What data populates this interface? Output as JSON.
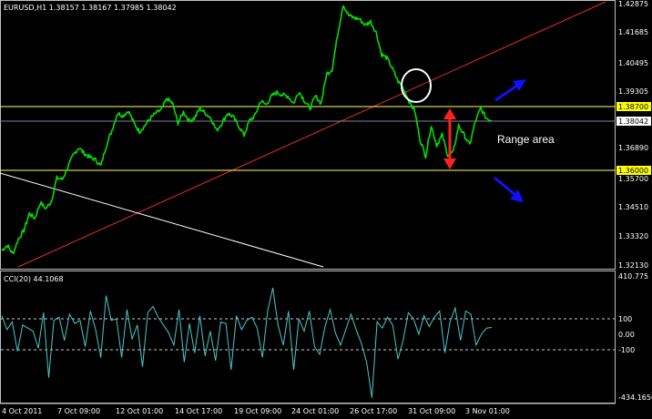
{
  "colors": {
    "background": "#000000",
    "frame": "#c0c0c0",
    "price": "#00e000",
    "trendline_up": "#e03020",
    "trendline_down": "#ffffff",
    "level": "#ffff66",
    "level_tag": "#ffff00",
    "current_price_line": "#8080a0",
    "current_price_tag": "#ffffff",
    "cci": "#4cc8c8",
    "cci_levels": "#c8c8c8",
    "arrow_blue": "#1010ff",
    "arrow_red": "#ff2020",
    "circle": "#ffffff"
  },
  "chart_data": [
    {
      "type": "line",
      "header": "EURUSD,H1  1.38157 1.38167 1.37985 1.38042",
      "symbol": "EURUSD,H1",
      "ohlc": {
        "open": "1.38157",
        "high": "1.38167",
        "low": "1.37985",
        "close": "1.38042"
      },
      "ylim": [
        1.3213,
        1.4278
      ],
      "y_ticks": [
        "1.42875",
        "1.41685",
        "1.40495",
        "1.39305",
        "1.38700",
        "1.38042",
        "1.36890",
        "1.35700",
        "1.36000",
        "1.34510",
        "1.33320",
        "1.32130"
      ],
      "x_ticks": [
        "4 Oct 2011",
        "7 Oct 09:00",
        "12 Oct 01:00",
        "14 Oct 17:00",
        "19 Oct 09:00",
        "24 Oct 01:00",
        "26 Oct 17:00",
        "31 Oct 09:00",
        "3 Nov 01:00"
      ],
      "series": [
        {
          "values": [
            1.327,
            1.329,
            1.3255,
            1.3315,
            1.335,
            1.342,
            1.34,
            1.3465,
            1.344,
            1.347,
            1.3565,
            1.356,
            1.361,
            1.366,
            1.369,
            1.3665,
            1.365,
            1.364,
            1.3615,
            1.37,
            1.376,
            1.383,
            1.382,
            1.384,
            1.379,
            1.3755,
            1.378,
            1.381,
            1.383,
            1.3845,
            1.389,
            1.387,
            1.379,
            1.3835,
            1.38,
            1.381,
            1.385,
            1.383,
            1.381,
            1.376,
            1.379,
            1.383,
            1.3815,
            1.378,
            1.374,
            1.38,
            1.382,
            1.388,
            1.3865,
            1.39,
            1.3915,
            1.3905,
            1.39,
            1.387,
            1.392,
            1.388,
            1.385,
            1.39,
            1.387,
            1.399,
            1.401,
            1.415,
            1.4275,
            1.423,
            1.422,
            1.4215,
            1.419,
            1.4205,
            1.416,
            1.407,
            1.4055,
            1.401,
            1.396,
            1.393,
            1.388,
            1.384,
            1.372,
            1.3655,
            1.378,
            1.37,
            1.374,
            1.366,
            1.367,
            1.378,
            1.374,
            1.37,
            1.3795,
            1.385,
            1.381,
            1.38
          ]
        }
      ],
      "levels": [
        {
          "value": 1.387,
          "label": "1.38700"
        },
        {
          "value": 1.36,
          "label": "1.36000"
        }
      ],
      "current_price": {
        "value": 1.38042,
        "label": "1.38042"
      },
      "annotations": [
        {
          "text": "Range area"
        }
      ]
    },
    {
      "type": "line",
      "header": "CCI(20) 44.1068",
      "indicator": "CCI(20)",
      "current_value": "44.1068",
      "ylim": [
        -434.1656,
        410.775
      ],
      "y_ticks": [
        "410.775",
        "100",
        "0.00",
        "-100",
        "-434.1656"
      ],
      "levels": [
        100,
        0,
        -100
      ],
      "series": [
        {
          "values": [
            120,
            30,
            80,
            -110,
            60,
            40,
            20,
            -90,
            140,
            -280,
            90,
            110,
            -40,
            130,
            70,
            90,
            -80,
            150,
            30,
            -150,
            250,
            90,
            100,
            -150,
            160,
            -30,
            60,
            -210,
            140,
            180,
            110,
            60,
            10,
            -70,
            160,
            -180,
            70,
            -120,
            120,
            -140,
            20,
            -170,
            80,
            70,
            -230,
            120,
            30,
            90,
            110,
            40,
            -150,
            150,
            300,
            60,
            -70,
            150,
            -230,
            100,
            20,
            150,
            -80,
            -130,
            50,
            160,
            10,
            -70,
            30,
            130,
            30,
            -60,
            -180,
            -410,
            80,
            40,
            110,
            60,
            -160,
            -40,
            140,
            100,
            0,
            120,
            50,
            110,
            150,
            -120,
            80,
            170,
            -40,
            150,
            130,
            -70,
            0,
            40,
            44
          ]
        }
      ]
    }
  ]
}
